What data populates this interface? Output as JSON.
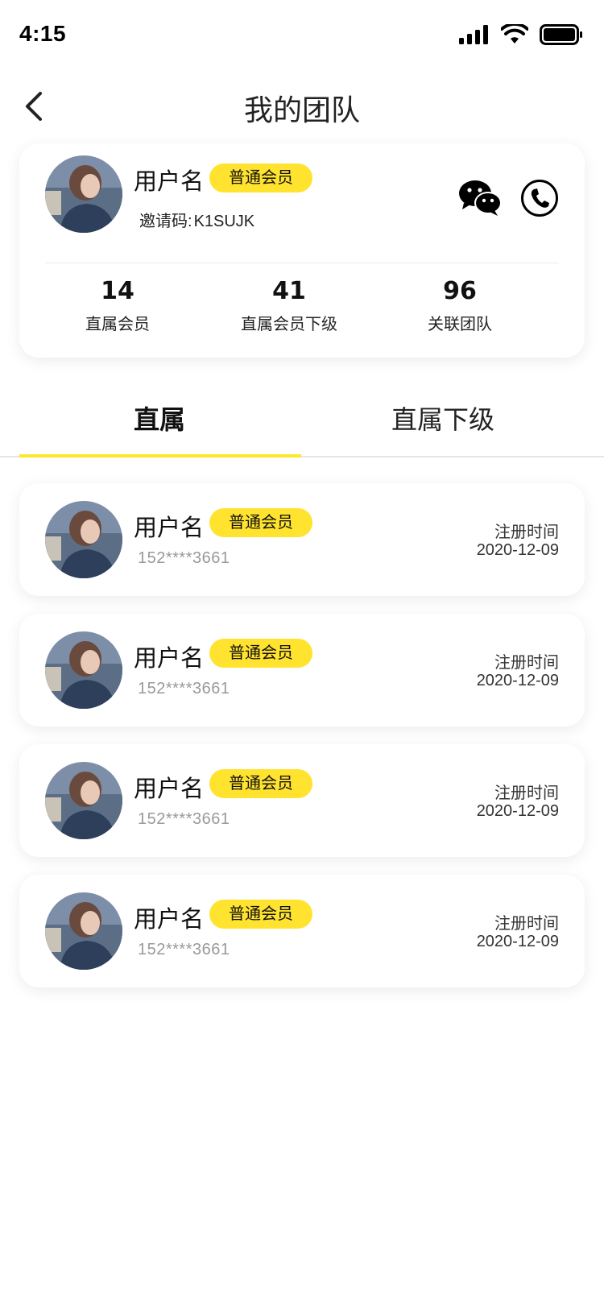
{
  "status_bar": {
    "time": "4:15",
    "icons": [
      "signal-icon",
      "wifi-icon",
      "battery-icon"
    ]
  },
  "nav": {
    "title": "我的团队",
    "back_icon": "chevron-left-icon"
  },
  "profile": {
    "name": "用户名",
    "badge": "普通会员",
    "invite_label": "邀请码:",
    "invite_code": "K1SUJK",
    "actions": [
      "wechat-icon",
      "phone-icon"
    ],
    "stats": [
      {
        "value": "14",
        "label": "直属会员"
      },
      {
        "value": "41",
        "label": "直属会员下级"
      },
      {
        "value": "96",
        "label": "关联团队"
      }
    ]
  },
  "tabs": [
    {
      "label": "直属",
      "active": true
    },
    {
      "label": "直属下级",
      "active": false
    }
  ],
  "members": [
    {
      "name": "用户名",
      "badge": "普通会员",
      "phone": "152****3661",
      "reg_label": "注册时间",
      "reg_date": "2020-12-09"
    },
    {
      "name": "用户名",
      "badge": "普通会员",
      "phone": "152****3661",
      "reg_label": "注册时间",
      "reg_date": "2020-12-09"
    },
    {
      "name": "用户名",
      "badge": "普通会员",
      "phone": "152****3661",
      "reg_label": "注册时间",
      "reg_date": "2020-12-09"
    },
    {
      "name": "用户名",
      "badge": "普通会员",
      "phone": "152****3661",
      "reg_label": "注册时间",
      "reg_date": "2020-12-09"
    }
  ],
  "colors": {
    "accent": "#ffe32e",
    "text": "#111111",
    "muted": "#999999"
  }
}
